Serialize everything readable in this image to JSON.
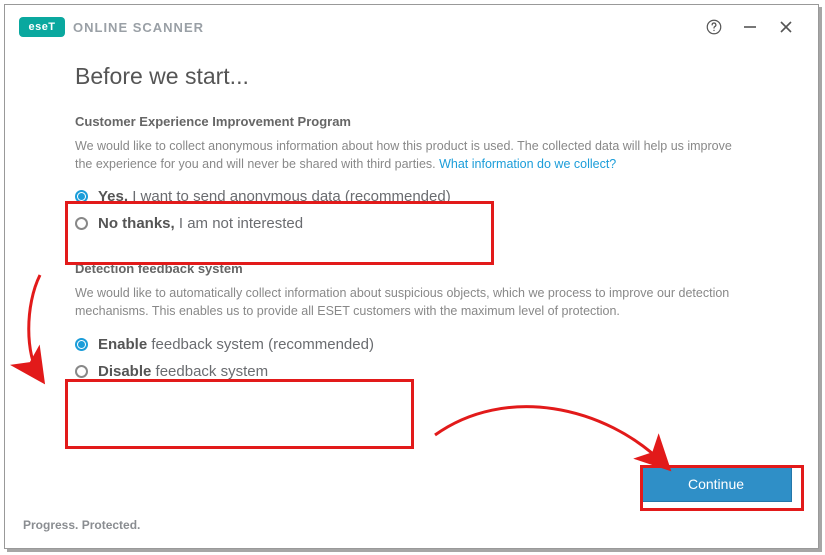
{
  "brand": {
    "badge": "eseT",
    "name": "ONLINE SCANNER"
  },
  "page": {
    "title": "Before we start..."
  },
  "ceip": {
    "title": "Customer Experience Improvement Program",
    "desc_prefix": "We would like to collect anonymous information about how this product is used. The collected data will help us improve the experience for you and will never be shared with third parties. ",
    "link": "What information do we collect?",
    "yes_bold": "Yes,",
    "yes_rest": " I want to send anonymous data (recommended)",
    "no_bold": "No thanks,",
    "no_rest": " I am not interested",
    "selected": "yes"
  },
  "dfs": {
    "title": "Detection feedback system",
    "desc": "We would like to automatically collect information about suspicious objects, which we process to improve our detection mechanisms. This enables us to provide all ESET customers with the maximum level of protection.",
    "enable_bold": "Enable",
    "enable_rest": " feedback system (recommended)",
    "disable_bold": "Disable",
    "disable_rest": " feedback system",
    "selected": "enable"
  },
  "buttons": {
    "continue": "Continue"
  },
  "footer": {
    "tagline": "Progress. Protected."
  }
}
